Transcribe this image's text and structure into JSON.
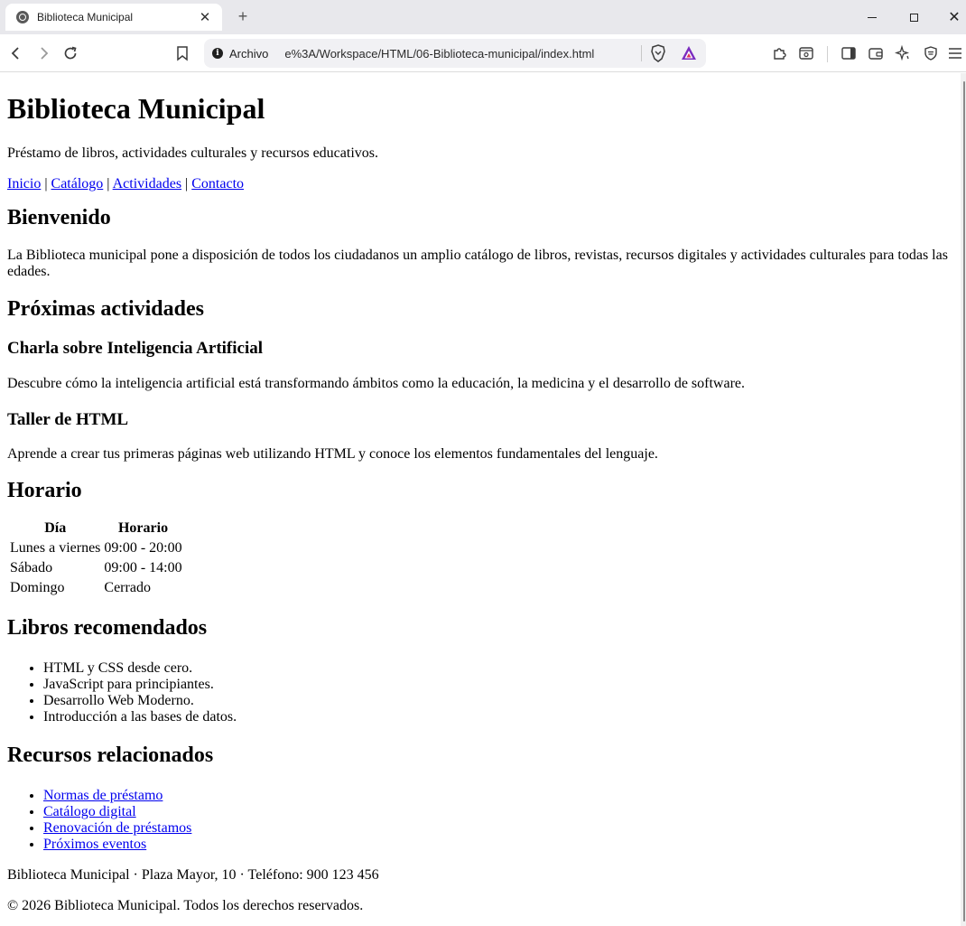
{
  "browser": {
    "tab_title": "Biblioteca Municipal",
    "tab_close": "✕",
    "new_tab": "+",
    "url_scheme": "Archivo",
    "url": "e%3A/Workspace/HTML/06-Biblioteca-municipal/index.html",
    "icons": [
      "back-icon",
      "forward-icon",
      "reload-icon",
      "bookmark-icon",
      "extensions-icon",
      "reading-mode-icon",
      "sidebar-icon",
      "wallet-icon",
      "leo-ai-icon",
      "vpn-shield-icon",
      "menu-icon"
    ]
  },
  "page": {
    "title": "Biblioteca Municipal",
    "subtitle": "Préstamo de libros, actividades culturales y recursos educativos.",
    "nav": {
      "items": [
        "Inicio",
        "Catálogo",
        "Actividades",
        "Contacto"
      ],
      "separator": "|"
    },
    "welcome": {
      "heading": "Bienvenido",
      "text": "La Biblioteca municipal pone a disposición de todos los ciudadanos un amplio catálogo de libros, revistas, recursos digitales y actividades culturales para todas las edades."
    },
    "activities": {
      "heading": "Próximas actividades",
      "items": [
        {
          "title": "Charla sobre Inteligencia Artificial",
          "text": "Descubre cómo la inteligencia artificial está transformando ámbitos como la educación, la medicina y el desarrollo de software."
        },
        {
          "title": "Taller de HTML",
          "text": "Aprende a crear tus primeras páginas web utilizando HTML y conoce los elementos fundamentales del lenguaje."
        }
      ]
    },
    "schedule": {
      "heading": "Horario",
      "columns": [
        "Día",
        "Horario"
      ],
      "rows": [
        [
          "Lunes a viernes",
          "09:00 - 20:00"
        ],
        [
          "Sábado",
          "09:00 - 14:00"
        ],
        [
          "Domingo",
          "Cerrado"
        ]
      ]
    },
    "books": {
      "heading": "Libros recomendados",
      "items": [
        "HTML y CSS desde cero.",
        "JavaScript para principiantes.",
        "Desarrollo Web Moderno.",
        "Introducción a las bases de datos."
      ]
    },
    "resources": {
      "heading": "Recursos relacionados",
      "items": [
        "Normas de préstamo",
        "Catálogo digital",
        "Renovación de préstamos",
        "Próximos eventos"
      ]
    },
    "footer": {
      "address": "Biblioteca Municipal · Plaza Mayor, 10 · Teléfono: 900 123 456",
      "copyright": "© 2026 Biblioteca Municipal. Todos los derechos reservados."
    }
  },
  "colors": {
    "link": "#0000ee",
    "tabbar_bg": "#e8e8ec",
    "urlbar_bg": "#f1f1f4"
  }
}
